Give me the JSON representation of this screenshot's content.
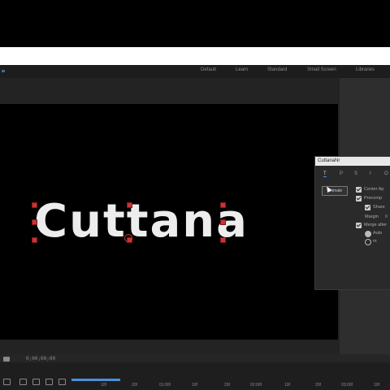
{
  "workspace": {
    "tabs": [
      "Default",
      "Learn",
      "Standard",
      "Small Screen",
      "Libraries"
    ]
  },
  "composition": {
    "text": "Cuttana"
  },
  "panel": {
    "title": "CuttanaNr",
    "tabs": [
      "T",
      "P",
      "S",
      "I",
      "O"
    ],
    "button": "Animate",
    "options": {
      "center": "Center Ap",
      "precomp": "Precomp",
      "share": "Share",
      "margin": "Margin",
      "margin_value": "0",
      "margin_after": "Merge after",
      "auto": "Auto",
      "m": "m"
    }
  },
  "timeline": {
    "timecode": "0;00;00;00",
    "ticks": [
      "10f",
      "20f",
      "01:00f",
      "10f",
      "20f",
      "02:00f",
      "10f",
      "20f",
      "03:00f",
      "10f",
      "20f",
      "04:00f"
    ]
  },
  "colors": {
    "handle": "#cc3333",
    "accent": "#4a8fd8"
  }
}
